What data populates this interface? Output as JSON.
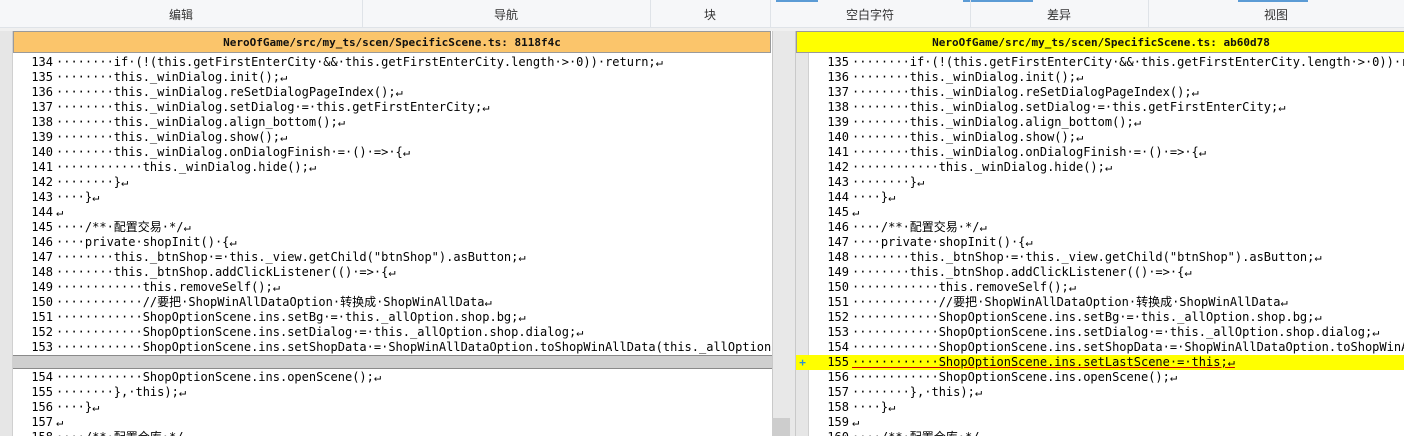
{
  "toolbar": {
    "groups": [
      {
        "label": "编辑"
      },
      {
        "label": "导航"
      },
      {
        "label": "块"
      },
      {
        "label": "空白字符"
      },
      {
        "label": "差异"
      },
      {
        "label": "视图"
      }
    ]
  },
  "left_pane": {
    "header": "NeroOfGame/src/my_ts/scen/SpecificScene.ts: 8118f4c",
    "lines": [
      {
        "n": "134",
        "code": "········if·(!(this.getFirstEnterCity·&&·this.getFirstEnterCity.length·>·0))·return;↵"
      },
      {
        "n": "135",
        "code": "········this._winDialog.init();↵"
      },
      {
        "n": "136",
        "code": "········this._winDialog.reSetDialogPageIndex();↵"
      },
      {
        "n": "137",
        "code": "········this._winDialog.setDialog·=·this.getFirstEnterCity;↵"
      },
      {
        "n": "138",
        "code": "········this._winDialog.align_bottom();↵"
      },
      {
        "n": "139",
        "code": "········this._winDialog.show();↵"
      },
      {
        "n": "140",
        "code": "········this._winDialog.onDialogFinish·=·()·=>·{↵"
      },
      {
        "n": "141",
        "code": "············this._winDialog.hide();↵"
      },
      {
        "n": "142",
        "code": "········}↵"
      },
      {
        "n": "143",
        "code": "····}↵"
      },
      {
        "n": "144",
        "code": "↵"
      },
      {
        "n": "145",
        "code": "····/**·配置交易·*/↵"
      },
      {
        "n": "146",
        "code": "····private·shopInit()·{↵"
      },
      {
        "n": "147",
        "code": "········this._btnShop·=·this._view.getChild(\"btnShop\").asButton;↵"
      },
      {
        "n": "148",
        "code": "········this._btnShop.addClickListener(()·=>·{↵"
      },
      {
        "n": "149",
        "code": "············this.removeSelf();↵"
      },
      {
        "n": "150",
        "code": "············//要把·ShopWinAllDataOption·转换成·ShopWinAllData↵"
      },
      {
        "n": "151",
        "code": "············ShopOptionScene.ins.setBg·=·this._allOption.shop.bg;↵"
      },
      {
        "n": "152",
        "code": "············ShopOptionScene.ins.setDialog·=·this._allOption.shop.dialog;↵"
      },
      {
        "n": "153",
        "code": "············ShopOptionScene.ins.setShopData·=·ShopWinAllDataOption.toShopWinAllData(this._allOption.sho"
      }
    ],
    "after_gap": [
      {
        "n": "154",
        "code": "············ShopOptionScene.ins.openScene();↵"
      },
      {
        "n": "155",
        "code": "········},·this);↵"
      },
      {
        "n": "156",
        "code": "····}↵"
      },
      {
        "n": "157",
        "code": "↵"
      },
      {
        "n": "158",
        "code": "····/**·配置仓库·*/"
      }
    ]
  },
  "right_pane": {
    "header": "NeroOfGame/src/my_ts/scen/SpecificScene.ts: ab60d78",
    "lines": [
      {
        "n": "135",
        "code": "········if·(!(this.getFirstEnterCity·&&·this.getFirstEnterCity.length·>·0))·retur"
      },
      {
        "n": "136",
        "code": "········this._winDialog.init();↵"
      },
      {
        "n": "137",
        "code": "········this._winDialog.reSetDialogPageIndex();↵"
      },
      {
        "n": "138",
        "code": "········this._winDialog.setDialog·=·this.getFirstEnterCity;↵"
      },
      {
        "n": "139",
        "code": "········this._winDialog.align_bottom();↵"
      },
      {
        "n": "140",
        "code": "········this._winDialog.show();↵"
      },
      {
        "n": "141",
        "code": "········this._winDialog.onDialogFinish·=·()·=>·{↵"
      },
      {
        "n": "142",
        "code": "············this._winDialog.hide();↵"
      },
      {
        "n": "143",
        "code": "········}↵"
      },
      {
        "n": "144",
        "code": "····}↵"
      },
      {
        "n": "145",
        "code": "↵"
      },
      {
        "n": "146",
        "code": "····/**·配置交易·*/↵"
      },
      {
        "n": "147",
        "code": "····private·shopInit()·{↵"
      },
      {
        "n": "148",
        "code": "········this._btnShop·=·this._view.getChild(\"btnShop\").asButton;↵"
      },
      {
        "n": "149",
        "code": "········this._btnShop.addClickListener(()·=>·{↵"
      },
      {
        "n": "150",
        "code": "············this.removeSelf();↵"
      },
      {
        "n": "151",
        "code": "············//要把·ShopWinAllDataOption·转换成·ShopWinAllData↵"
      },
      {
        "n": "152",
        "code": "············ShopOptionScene.ins.setBg·=·this._allOption.shop.bg;↵"
      },
      {
        "n": "153",
        "code": "············ShopOptionScene.ins.setDialog·=·this._allOption.shop.dialog;↵"
      },
      {
        "n": "154",
        "code": "············ShopOptionScene.ins.setShopData·=·ShopWinAllDataOption.toShopWinAllD"
      },
      {
        "n": "155",
        "code": "············ShopOptionScene.ins.setLastScene·=·this;↵",
        "added": true,
        "marker": "+"
      },
      {
        "n": "156",
        "code": "············ShopOptionScene.ins.openScene();↵"
      },
      {
        "n": "157",
        "code": "········},·this);↵"
      },
      {
        "n": "158",
        "code": "····}↵"
      },
      {
        "n": "159",
        "code": "↵"
      },
      {
        "n": "160",
        "code": "····/**·配置仓库·*/"
      }
    ]
  },
  "colors": {
    "left_header": "#fbc56b",
    "right_header": "#ffff00",
    "added_line": "#ffff00",
    "added_marker": "#2a8ed6"
  }
}
